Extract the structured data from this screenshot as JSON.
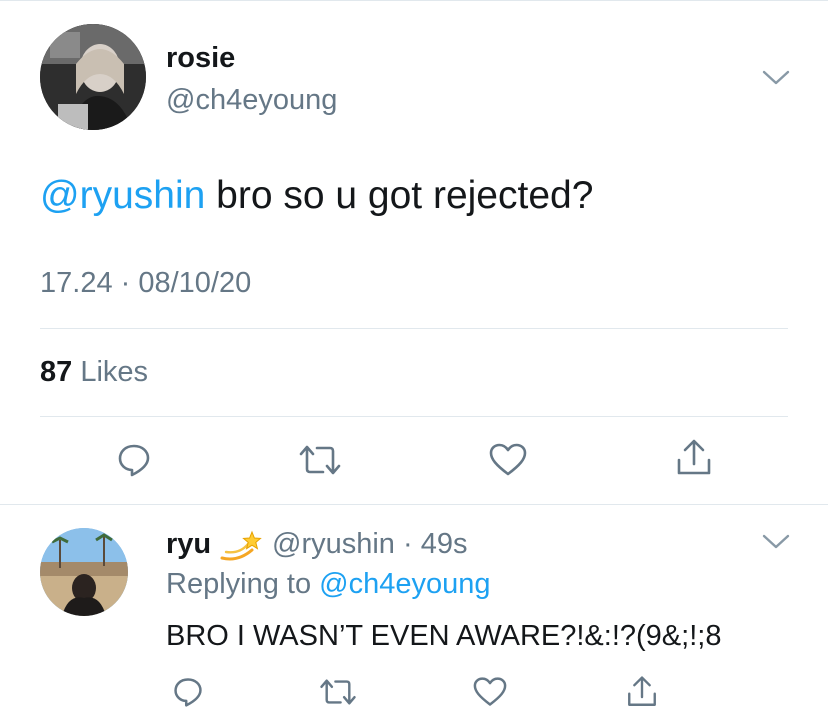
{
  "tweet": {
    "display_name": "rosie",
    "handle": "@ch4eyoung",
    "mention": "@ryushin",
    "text": " bro so u got rejected?",
    "time": "17.24 · 08/10/20",
    "likes_count": "87",
    "likes_label": "Likes"
  },
  "reply": {
    "display_name": "ryu",
    "emoji": "dizzy-emoji",
    "handle_time": "@ryushin · 49s",
    "replying_label": "Replying to ",
    "replying_handle": "@ch4eyoung",
    "text": "BRO I WASN’T EVEN AWARE?!&:!?(9&;!;8"
  },
  "colors": {
    "accent": "#1da1f2",
    "muted": "#657786",
    "divider": "#e1e8ed",
    "text": "#14171a"
  },
  "icons": [
    "reply-icon",
    "retweet-icon",
    "like-icon",
    "share-icon",
    "chevron-down-icon"
  ]
}
